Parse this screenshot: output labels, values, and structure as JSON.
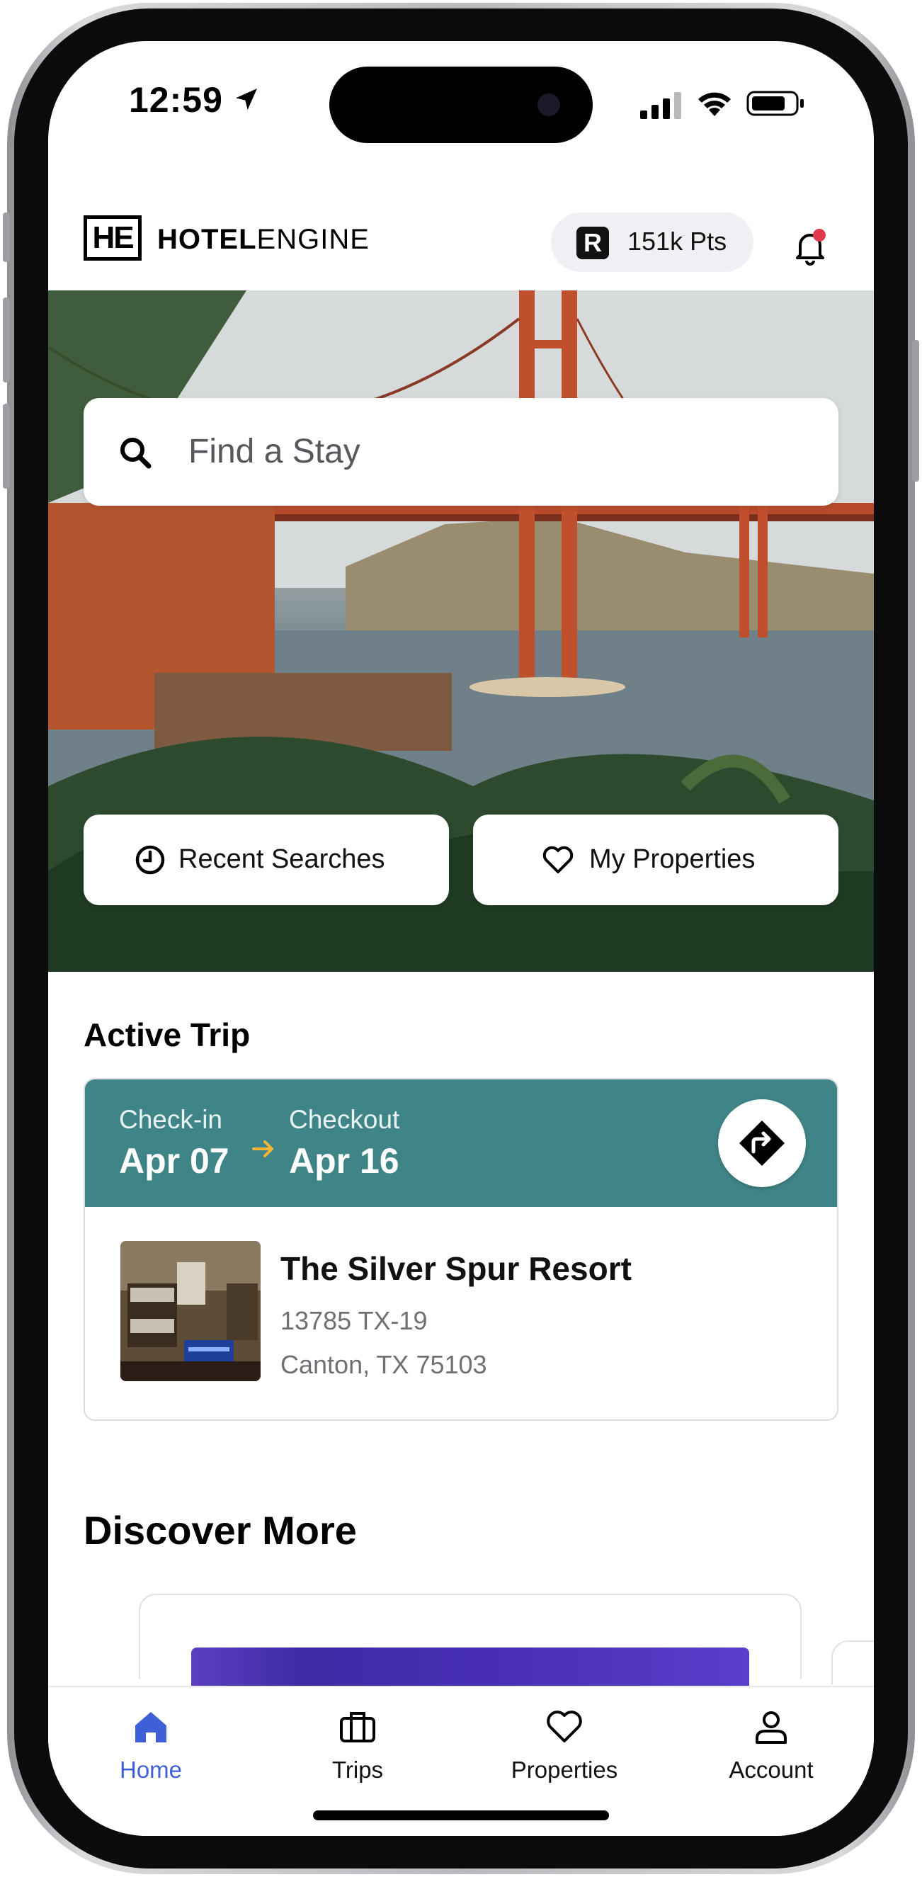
{
  "status_bar": {
    "time": "12:59"
  },
  "header": {
    "logo_mark": "HE",
    "logo_bold": "HOTEL",
    "logo_rest": "ENGINE",
    "points_icon": "R",
    "points_label": "151k Pts"
  },
  "hero": {
    "search_placeholder": "Find a Stay",
    "recent_searches_label": "Recent Searches",
    "my_properties_label": "My Properties"
  },
  "active_trip": {
    "title": "Active Trip",
    "checkin_label": "Check-in",
    "checkin_date": "Apr 07",
    "checkout_label": "Checkout",
    "checkout_date": "Apr 16",
    "hotel_name": "The Silver Spur Resort",
    "address_line1": "13785 TX-19",
    "address_line2": "Canton, TX 75103"
  },
  "discover": {
    "title": "Discover More"
  },
  "tabs": [
    {
      "label": "Home",
      "icon": "home-icon",
      "active": true
    },
    {
      "label": "Trips",
      "icon": "briefcase-icon",
      "active": false
    },
    {
      "label": "Properties",
      "icon": "heart-icon",
      "active": false
    },
    {
      "label": "Account",
      "icon": "person-icon",
      "active": false
    }
  ],
  "colors": {
    "accent": "#3f5fd6",
    "trip_header": "#3f8587",
    "notification_dot": "#e0394b",
    "arrow": "#f2b63a"
  }
}
